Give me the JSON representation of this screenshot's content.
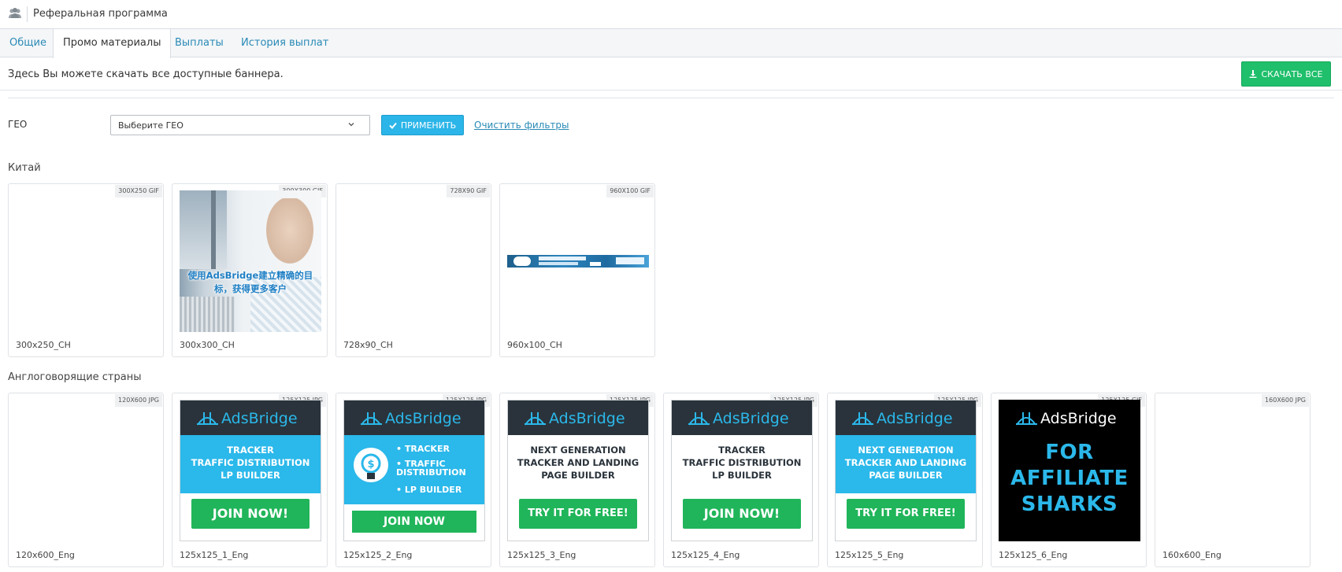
{
  "header": {
    "title": "Реферальная программа",
    "icon": "users-icon"
  },
  "tabs": [
    {
      "label": "Общие"
    },
    {
      "label": "Промо материалы"
    },
    {
      "label": "Выплаты"
    },
    {
      "label": "История выплат"
    }
  ],
  "info": {
    "text": "Здесь Вы можете скачать все доступные баннера.",
    "download_all": "СКАЧАТЬ ВСЕ"
  },
  "filter": {
    "label": "ГЕО",
    "placeholder": "Выберите ГЕО",
    "apply": "ПРИМЕНИТЬ",
    "clear": "Очистить фильтры"
  },
  "sections": [
    {
      "title": "Китай",
      "banners": [
        {
          "badge": "300X250 GIF",
          "caption": "300x250_CH"
        },
        {
          "badge": "300X300 GIF",
          "caption": "300x300_CH",
          "image_text": "使用AdsBridge建立精确的目标，获得更多客户"
        },
        {
          "badge": "728X90 GIF",
          "caption": "728x90_CH"
        },
        {
          "badge": "960X100 GIF",
          "caption": "960x100_CH"
        }
      ]
    },
    {
      "title": "Англоговорящие страны",
      "banners": [
        {
          "badge": "120X600 JPG",
          "caption": "120x600_Eng"
        },
        {
          "badge": "125X125 JPG",
          "caption": "125x125_1_Eng",
          "lines": [
            "TRACKER",
            "TRAFFIC DISTRIBUTION",
            "LP BUILDER"
          ],
          "cta": "JOIN NOW!"
        },
        {
          "badge": "125X125 JPG",
          "caption": "125x125_2_Eng",
          "lines": [
            "• TRACKER",
            "• TRAFFIC",
            "   DISTRIBUTION",
            "• LP BUILDER"
          ],
          "cta": "JOIN NOW"
        },
        {
          "badge": "125X125 JPG",
          "caption": "125x125_3_Eng",
          "lines": [
            "NEXT GENERATION",
            "TRACKER AND LANDING",
            "PAGE BUILDER"
          ],
          "cta": "TRY IT FOR FREE!"
        },
        {
          "badge": "125X125 JPG",
          "caption": "125x125_4_Eng",
          "lines": [
            "TRACKER",
            "TRAFFIC DISTRIBUTION",
            "LP BUILDER"
          ],
          "cta": "JOIN NOW!"
        },
        {
          "badge": "125X125 JPG",
          "caption": "125x125_5_Eng",
          "lines": [
            "NEXT GENERATION",
            "TRACKER AND LANDING",
            "PAGE BUILDER"
          ],
          "cta": "TRY IT FOR FREE!"
        },
        {
          "badge": "125X125 GIF",
          "caption": "125x125_6_Eng",
          "lines": [
            "FOR",
            "AFFILIATE",
            "SHARKS"
          ]
        },
        {
          "badge": "160X600 JPG",
          "caption": "160x600_Eng"
        }
      ]
    }
  ],
  "brand": {
    "logo_text": "AdsBridge",
    "accent": "#2bb8ea",
    "green": "#20b55a",
    "dark": "#2a333b"
  }
}
